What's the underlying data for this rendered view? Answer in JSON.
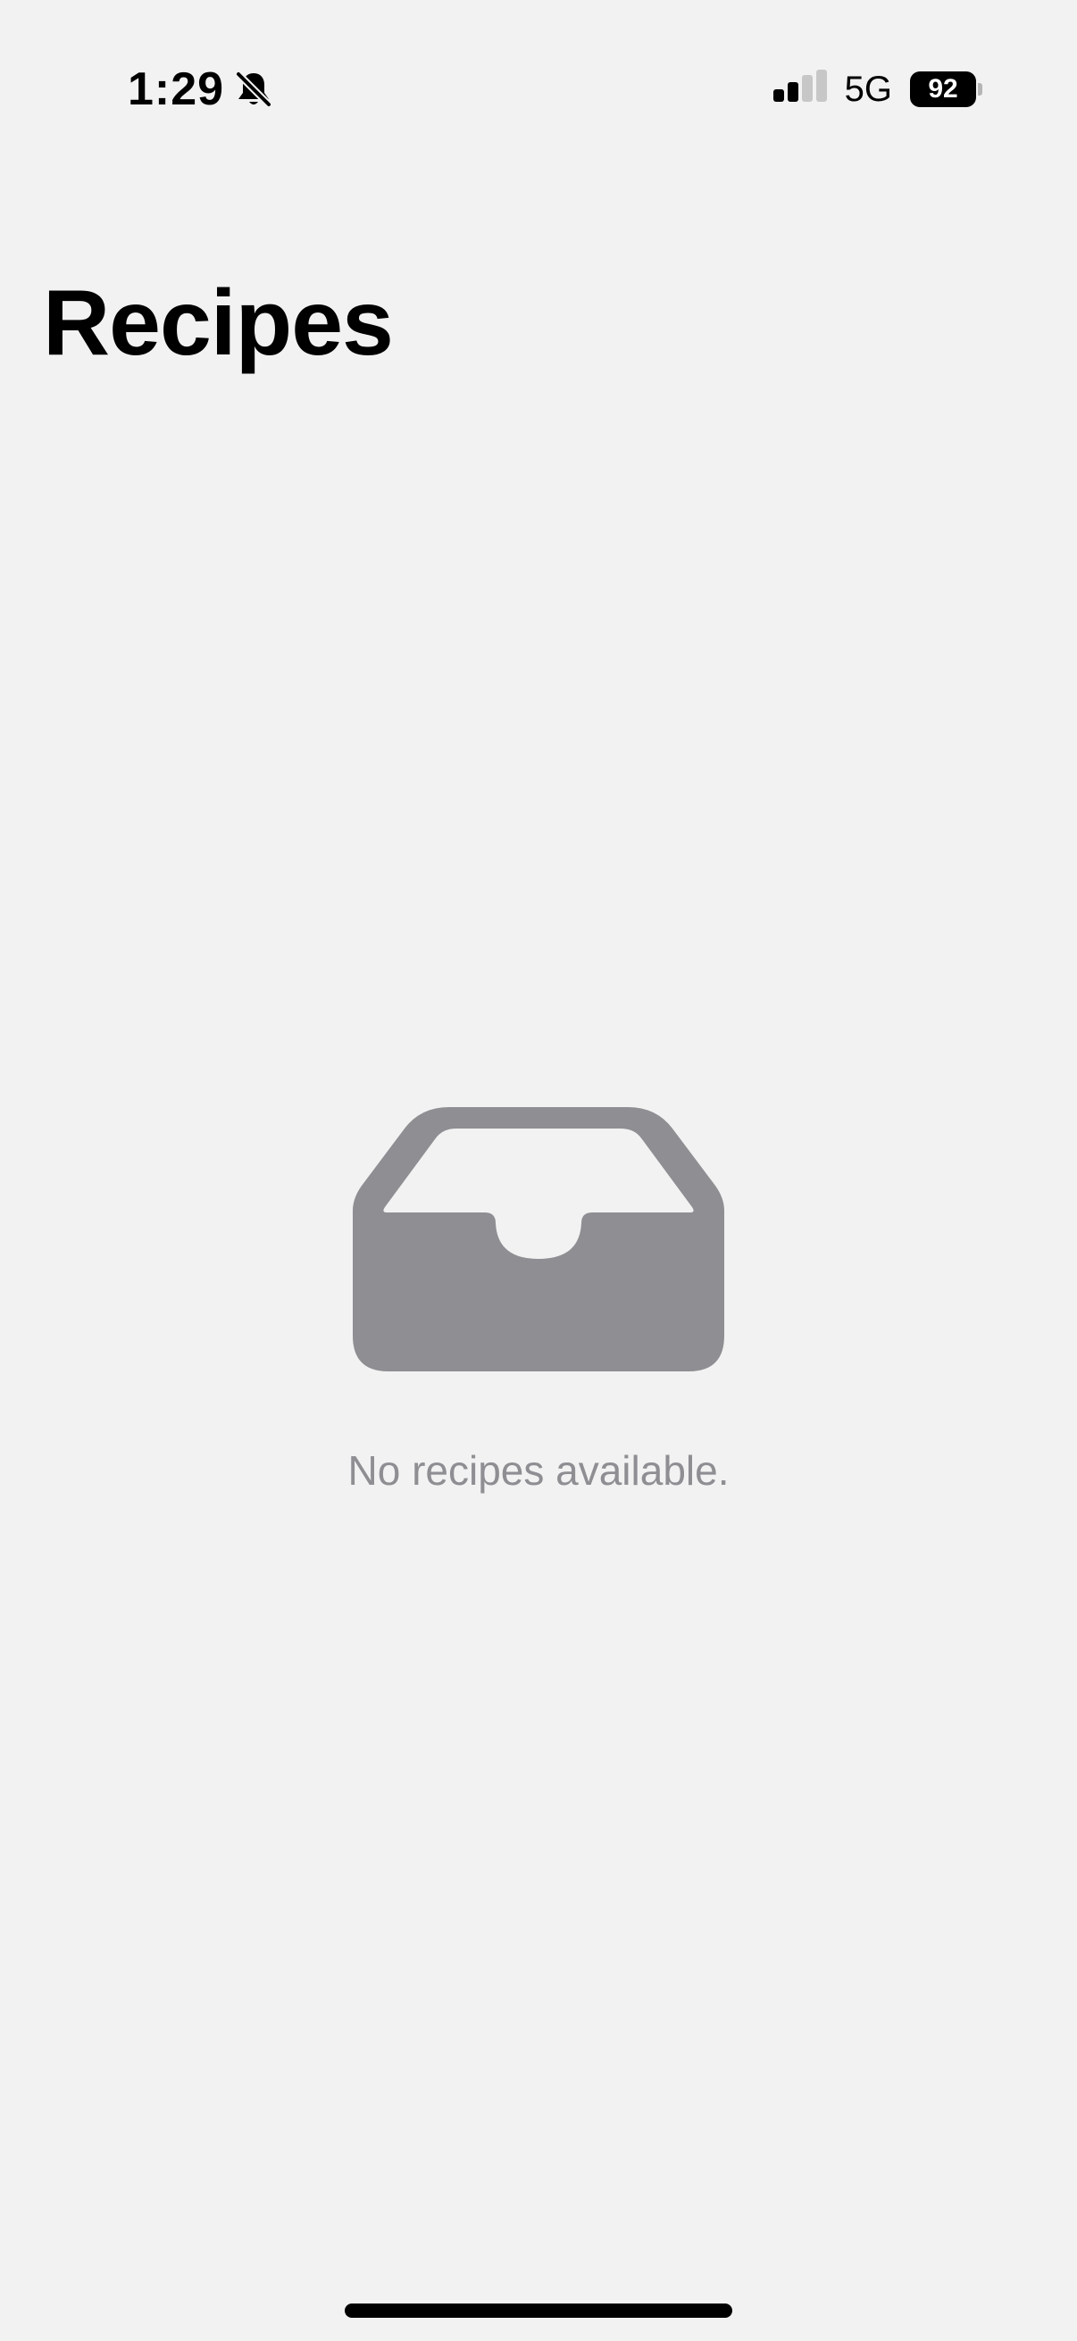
{
  "status_bar": {
    "time": "1:29",
    "network": "5G",
    "battery_level": "92",
    "bell_icon": "bell-slash-icon",
    "signal_icon": "cellular-signal-icon",
    "signal_bars_active": 2,
    "signal_bars_total": 4
  },
  "header": {
    "title": "Recipes"
  },
  "empty_state": {
    "icon": "tray-icon",
    "message": "No recipes available."
  },
  "colors": {
    "background": "#f2f2f2",
    "title": "#000000",
    "icon": "#8e8e93",
    "secondary_text": "#8e8e93"
  }
}
